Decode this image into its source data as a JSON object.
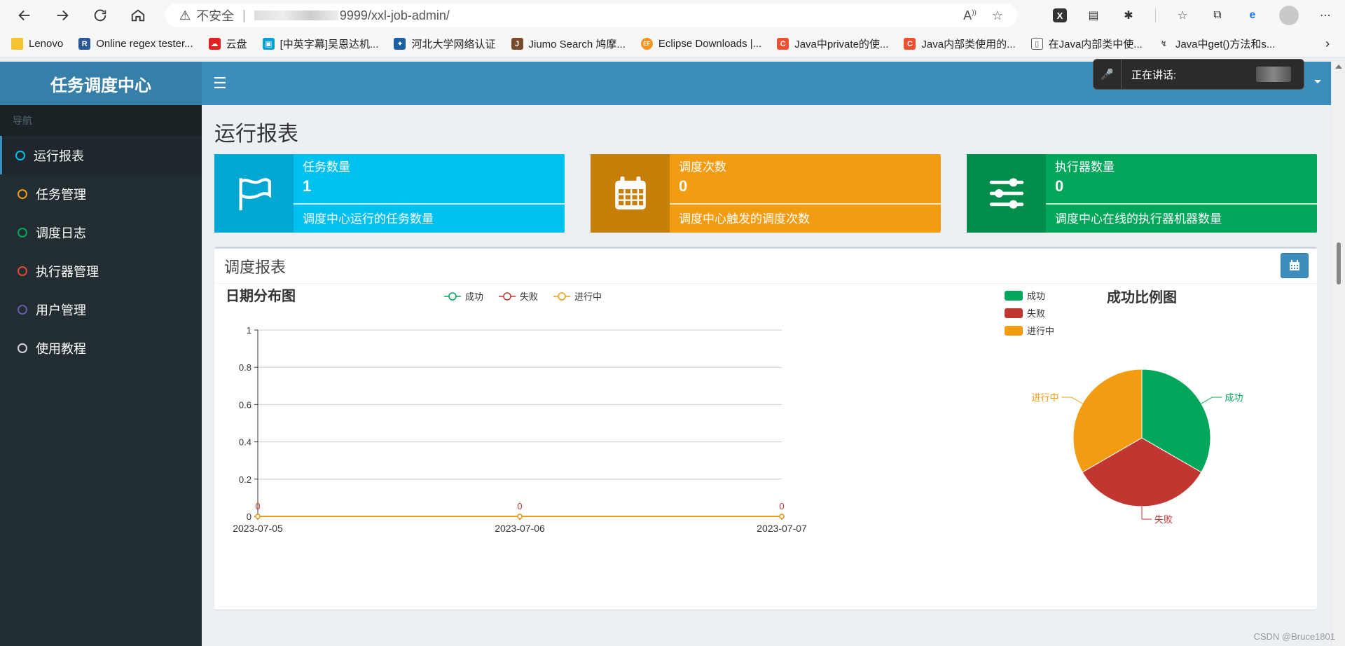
{
  "browser": {
    "insecure_label": "不安全",
    "url": "9999/xxl-job-admin/",
    "bookmarks": [
      {
        "label": "Lenovo",
        "icon": "folder-icon",
        "color": "#f4c430"
      },
      {
        "label": "Online regex tester...",
        "icon": "R",
        "color": "#2b5797"
      },
      {
        "label": "云盘",
        "icon": "cloud-icon",
        "color": "#e02020"
      },
      {
        "label": "[中英字幕]吴恩达机...",
        "icon": "tv-icon",
        "color": "#00a1d6"
      },
      {
        "label": "河北大学网络认证",
        "icon": "globe-icon",
        "color": "#1a5fa0"
      },
      {
        "label": "Jiumo Search 鸠摩...",
        "icon": "J",
        "color": "#7a4a2a"
      },
      {
        "label": "Eclipse Downloads |...",
        "icon": "EF",
        "color": "#f7941e"
      },
      {
        "label": "Java中private的使...",
        "icon": "C",
        "color": "#f05032"
      },
      {
        "label": "Java内部类使用的...",
        "icon": "C",
        "color": "#f05032"
      },
      {
        "label": "在Java内部类中使...",
        "icon": "doc-icon",
        "color": "#555555"
      },
      {
        "label": "Java中get()方法和s...",
        "icon": "bird-icon",
        "color": "#555555"
      }
    ]
  },
  "app": {
    "logo": "任务调度中心",
    "nav_header": "导航",
    "nav_items": [
      {
        "label": "运行报表",
        "ring_color": "#00c0ef",
        "active": true
      },
      {
        "label": "任务管理",
        "ring_color": "#f39c12",
        "active": false
      },
      {
        "label": "调度日志",
        "ring_color": "#00a65a",
        "active": false
      },
      {
        "label": "执行器管理",
        "ring_color": "#dd4b39",
        "active": false
      },
      {
        "label": "用户管理",
        "ring_color": "#605ca8",
        "active": false
      },
      {
        "label": "使用教程",
        "ring_color": "#d2d6de",
        "active": false
      }
    ],
    "speaking_label": "正在讲话:",
    "page_title": "运行报表",
    "info_boxes": [
      {
        "label": "任务数量",
        "number": "1",
        "desc": "调度中心运行的任务数量",
        "icon": "flag-icon"
      },
      {
        "label": "调度次数",
        "number": "0",
        "desc": "调度中心触发的调度次数",
        "icon": "calendar-icon"
      },
      {
        "label": "执行器数量",
        "number": "0",
        "desc": "调度中心在线的执行器机器数量",
        "icon": "sliders-icon"
      }
    ],
    "report_title": "调度报表"
  },
  "chart_data": [
    {
      "type": "line",
      "title": "日期分布图",
      "x": [
        "2023-07-05",
        "2023-07-06",
        "2023-07-07"
      ],
      "series": [
        {
          "name": "成功",
          "color": "#00a65a",
          "values": [
            0,
            0,
            0
          ]
        },
        {
          "name": "失败",
          "color": "#c23632",
          "values": [
            0,
            0,
            0
          ]
        },
        {
          "name": "进行中",
          "color": "#f39c12",
          "values": [
            0,
            0,
            0
          ]
        }
      ],
      "ylim": [
        0,
        1
      ],
      "yticks": [
        "0",
        "0.2",
        "0.4",
        "0.6",
        "0.8",
        "1"
      ],
      "data_labels": [
        "0",
        "0",
        "0"
      ],
      "legend_position": "top-center",
      "grid": true
    },
    {
      "type": "pie",
      "title": "成功比例图",
      "slices": [
        {
          "name": "成功",
          "color": "#00a65a",
          "value": 1
        },
        {
          "name": "失败",
          "color": "#c23632",
          "value": 1
        },
        {
          "name": "进行中",
          "color": "#f39c12",
          "value": 1
        }
      ],
      "legend_position": "top-left"
    }
  ],
  "watermark": "CSDN @Bruce1801"
}
